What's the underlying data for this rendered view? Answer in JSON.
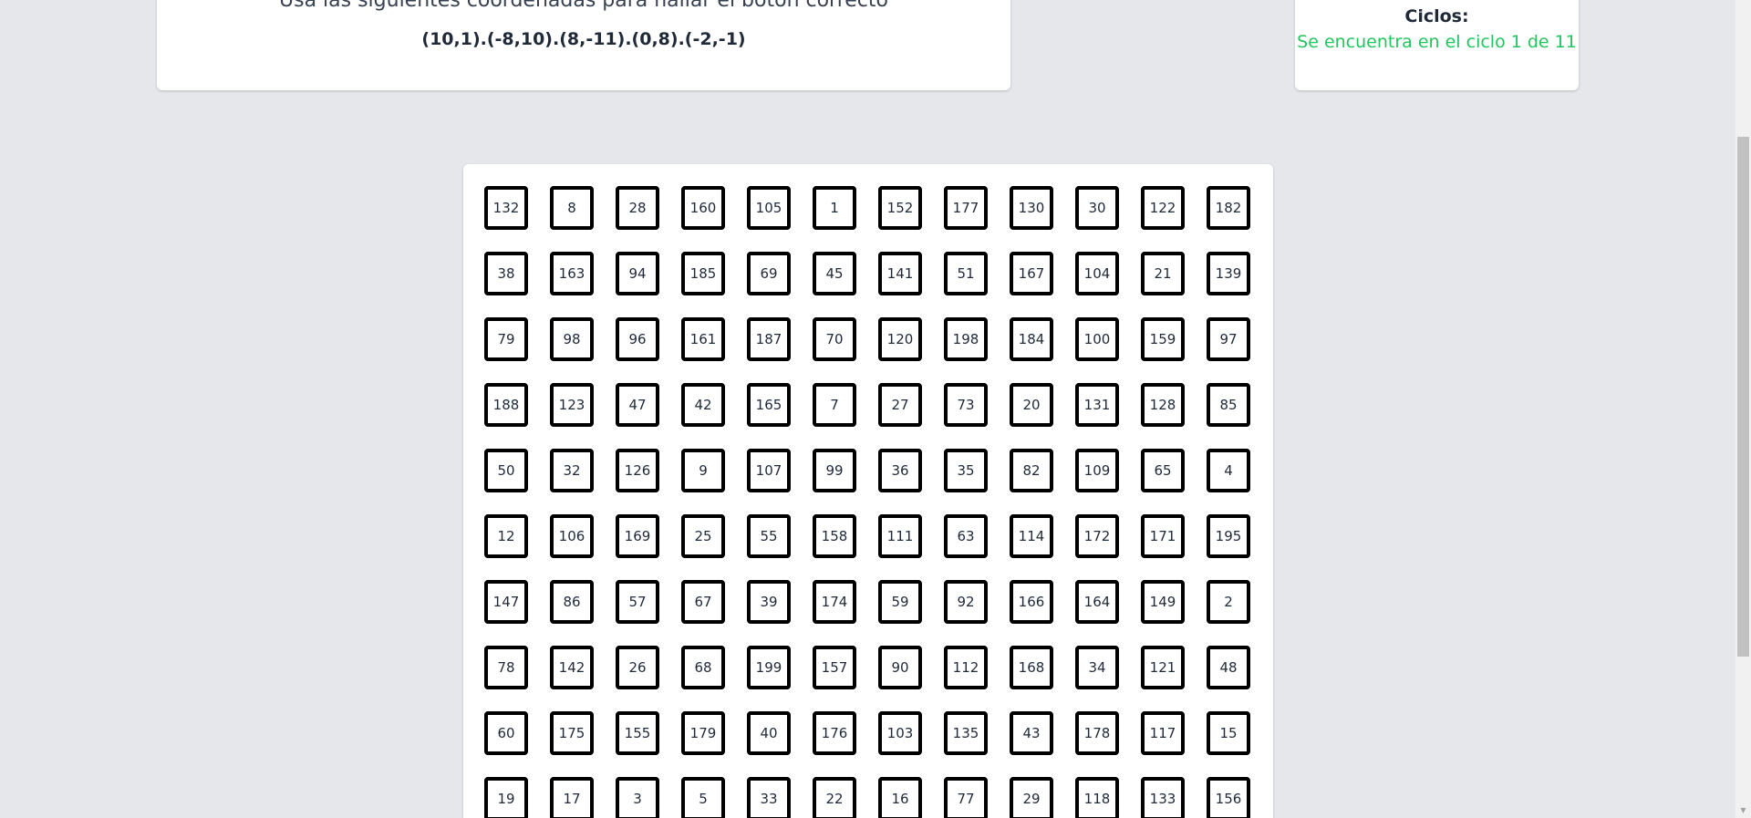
{
  "instructions": {
    "text": "Usa las siguientes coordenadas para hallar el botón correcto",
    "coordinates": "(10,1).(-8,10).(8,-11).(0,8).(-2,-1)"
  },
  "cycles": {
    "label": "Ciclos:",
    "status": "Se encuentra en el ciclo 1 de 11",
    "status_color": "#22c55e"
  },
  "grid": {
    "rows": [
      [
        "132",
        "8",
        "28",
        "160",
        "105",
        "1",
        "152",
        "177",
        "130",
        "30",
        "122",
        "182"
      ],
      [
        "38",
        "163",
        "94",
        "185",
        "69",
        "45",
        "141",
        "51",
        "167",
        "104",
        "21",
        "139"
      ],
      [
        "79",
        "98",
        "96",
        "161",
        "187",
        "70",
        "120",
        "198",
        "184",
        "100",
        "159",
        "97"
      ],
      [
        "188",
        "123",
        "47",
        "42",
        "165",
        "7",
        "27",
        "73",
        "20",
        "131",
        "128",
        "85"
      ],
      [
        "50",
        "32",
        "126",
        "9",
        "107",
        "99",
        "36",
        "35",
        "82",
        "109",
        "65",
        "4"
      ],
      [
        "12",
        "106",
        "169",
        "25",
        "55",
        "158",
        "111",
        "63",
        "114",
        "172",
        "171",
        "195"
      ],
      [
        "147",
        "86",
        "57",
        "67",
        "39",
        "174",
        "59",
        "92",
        "166",
        "164",
        "149",
        "2"
      ],
      [
        "78",
        "142",
        "26",
        "68",
        "199",
        "157",
        "90",
        "112",
        "168",
        "34",
        "121",
        "48"
      ],
      [
        "60",
        "175",
        "155",
        "179",
        "40",
        "176",
        "103",
        "135",
        "43",
        "178",
        "117",
        "15"
      ],
      [
        "19",
        "17",
        "3",
        "5",
        "33",
        "22",
        "16",
        "77",
        "29",
        "118",
        "133",
        "156"
      ]
    ]
  },
  "scrollbar": {
    "down_arrow_icon": "triangle-down-icon"
  }
}
